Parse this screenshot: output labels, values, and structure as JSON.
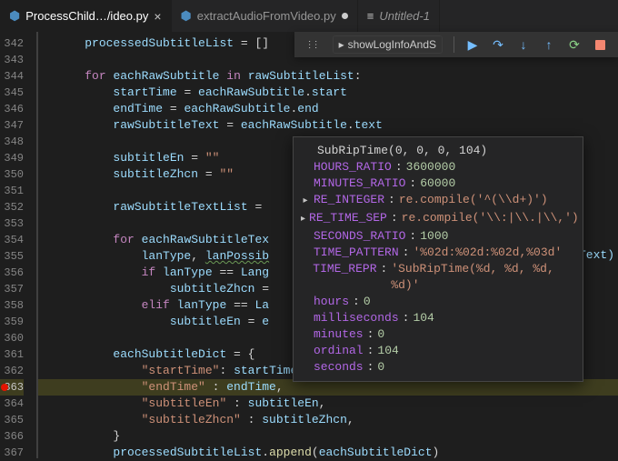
{
  "tabs": [
    {
      "icon": "py",
      "label": "ProcessChild…",
      "label2": "/ideo.py",
      "active": true,
      "close": true
    },
    {
      "icon": "py",
      "label": "extractAudioFromVideo.py",
      "modified": true
    },
    {
      "icon": "",
      "label": "Untitled-1",
      "italic": true
    }
  ],
  "debug": {
    "fnName": "showLogInfoAndS",
    "tri": "▸"
  },
  "lineStart": 342,
  "lines": [
    [
      {
        "cls": "var",
        "t": "processedSubtitleList"
      },
      {
        "cls": "op",
        "t": " = []"
      }
    ],
    [],
    [
      {
        "cls": "kw",
        "t": "for"
      },
      {
        "cls": "text",
        "t": " "
      },
      {
        "cls": "var",
        "t": "eachRawSubtitle"
      },
      {
        "cls": "text",
        "t": " "
      },
      {
        "cls": "kw",
        "t": "in"
      },
      {
        "cls": "text",
        "t": " "
      },
      {
        "cls": "var",
        "t": "rawSubtitleList"
      },
      {
        "cls": "punc",
        "t": ":"
      }
    ],
    [
      {
        "indent": 1
      },
      {
        "cls": "var",
        "t": "startTime"
      },
      {
        "cls": "op",
        "t": " = "
      },
      {
        "cls": "var",
        "t": "eachRawSubtitle"
      },
      {
        "cls": "punc",
        "t": "."
      },
      {
        "cls": "prop",
        "t": "start"
      }
    ],
    [
      {
        "indent": 1
      },
      {
        "cls": "var",
        "t": "endTime"
      },
      {
        "cls": "op",
        "t": " = "
      },
      {
        "cls": "var",
        "t": "eachRawSubtitle"
      },
      {
        "cls": "punc",
        "t": "."
      },
      {
        "cls": "prop",
        "t": "end"
      }
    ],
    [
      {
        "indent": 1
      },
      {
        "cls": "var",
        "t": "rawSubtitleText"
      },
      {
        "cls": "op",
        "t": " = "
      },
      {
        "cls": "var",
        "t": "eachRawSubtitle"
      },
      {
        "cls": "punc",
        "t": "."
      },
      {
        "cls": "prop",
        "t": "text"
      }
    ],
    [],
    [
      {
        "indent": 1
      },
      {
        "cls": "var",
        "t": "subtitleEn"
      },
      {
        "cls": "op",
        "t": " = "
      },
      {
        "cls": "str",
        "t": "\"\""
      }
    ],
    [
      {
        "indent": 1
      },
      {
        "cls": "var",
        "t": "subtitleZhcn"
      },
      {
        "cls": "op",
        "t": " = "
      },
      {
        "cls": "str",
        "t": "\"\""
      }
    ],
    [],
    [
      {
        "indent": 1
      },
      {
        "cls": "var",
        "t": "rawSubtitleTextList"
      },
      {
        "cls": "op",
        "t": " = "
      }
    ],
    [],
    [
      {
        "indent": 1
      },
      {
        "cls": "kw",
        "t": "for"
      },
      {
        "cls": "text",
        "t": " "
      },
      {
        "cls": "var",
        "t": "eachRawSubtitleTex"
      }
    ],
    [
      {
        "indent": 2
      },
      {
        "cls": "var",
        "t": "lanType"
      },
      {
        "cls": "punc",
        "t": ", "
      },
      {
        "cls": "var squiggle",
        "t": "lanPossib"
      }
    ],
    [
      {
        "indent": 2
      },
      {
        "cls": "kw",
        "t": "if"
      },
      {
        "cls": "text",
        "t": " "
      },
      {
        "cls": "var",
        "t": "lanType"
      },
      {
        "cls": "op",
        "t": " == "
      },
      {
        "cls": "var",
        "t": "Lang"
      }
    ],
    [
      {
        "indent": 3
      },
      {
        "cls": "var",
        "t": "subtitleZhcn"
      },
      {
        "cls": "op",
        "t": " ="
      }
    ],
    [
      {
        "indent": 2
      },
      {
        "cls": "kw",
        "t": "elif"
      },
      {
        "cls": "text",
        "t": " "
      },
      {
        "cls": "var",
        "t": "lanType"
      },
      {
        "cls": "op",
        "t": " == "
      },
      {
        "cls": "var",
        "t": "La"
      }
    ],
    [
      {
        "indent": 3
      },
      {
        "cls": "var",
        "t": "subtitleEn"
      },
      {
        "cls": "op",
        "t": " = "
      },
      {
        "cls": "var",
        "t": "e"
      }
    ],
    [],
    [
      {
        "indent": 1
      },
      {
        "cls": "var",
        "t": "eachSubtitleDict"
      },
      {
        "cls": "op",
        "t": " = {"
      }
    ],
    [
      {
        "indent": 2
      },
      {
        "cls": "str",
        "t": "\"startTime\""
      },
      {
        "cls": "punc",
        "t": ": "
      },
      {
        "cls": "var",
        "t": "startTime"
      },
      {
        "cls": "punc",
        "t": ","
      }
    ],
    [
      {
        "indent": 2
      },
      {
        "cls": "str",
        "t": "\"endTime\""
      },
      {
        "cls": "punc",
        "t": " : "
      },
      {
        "cls": "var",
        "t": "endTime"
      },
      {
        "cls": "punc",
        "t": ","
      }
    ],
    [
      {
        "indent": 2
      },
      {
        "cls": "str",
        "t": "\"subtitleEn\""
      },
      {
        "cls": "punc",
        "t": " : "
      },
      {
        "cls": "var",
        "t": "subtitleEn"
      },
      {
        "cls": "punc",
        "t": ","
      }
    ],
    [
      {
        "indent": 2
      },
      {
        "cls": "str",
        "t": "\"subtitleZhcn\""
      },
      {
        "cls": "punc",
        "t": " : "
      },
      {
        "cls": "var",
        "t": "subtitleZhcn"
      },
      {
        "cls": "punc",
        "t": ","
      }
    ],
    [
      {
        "indent": 1
      },
      {
        "cls": "punc",
        "t": "}"
      }
    ],
    [
      {
        "indent": 1
      },
      {
        "cls": "var",
        "t": "processedSubtitleList"
      },
      {
        "cls": "punc",
        "t": "."
      },
      {
        "cls": "fn",
        "t": "append"
      },
      {
        "cls": "punc",
        "t": "("
      },
      {
        "cls": "var",
        "t": "eachSubtitleDict"
      },
      {
        "cls": "punc",
        "t": ")"
      }
    ]
  ],
  "tailText": "eText)",
  "highlightLine": 363,
  "breakpointLine": 363,
  "popup": [
    {
      "tri": "",
      "key": "",
      "sep": "",
      "val_cls": "p-text",
      "val": "SubRipTime(0, 0, 0, 104)"
    },
    {
      "tri": "",
      "key": "HOURS_RATIO",
      "sep": ": ",
      "val_cls": "p-num",
      "val": "3600000"
    },
    {
      "tri": "",
      "key": "MINUTES_RATIO",
      "sep": ": ",
      "val_cls": "p-num",
      "val": "60000"
    },
    {
      "tri": "▸",
      "key": "RE_INTEGER",
      "sep": ": ",
      "val_cls": "p-str",
      "val": "re.compile('^(\\\\d+)')"
    },
    {
      "tri": "▸",
      "key": "RE_TIME_SEP",
      "sep": ": ",
      "val_cls": "p-str",
      "val": "re.compile('\\\\:|\\\\.|\\\\,')"
    },
    {
      "tri": "",
      "key": "SECONDS_RATIO",
      "sep": ": ",
      "val_cls": "p-num",
      "val": "1000"
    },
    {
      "tri": "",
      "key": "TIME_PATTERN",
      "sep": ": ",
      "val_cls": "p-str",
      "val": "'%02d:%02d:%02d,%03d'"
    },
    {
      "tri": "",
      "key": "TIME_REPR",
      "sep": ": ",
      "val_cls": "p-str",
      "val": "'SubRipTime(%d, %d, %d, %d)'"
    },
    {
      "tri": "",
      "key": "hours",
      "sep": ": ",
      "val_cls": "p-num",
      "val": "0"
    },
    {
      "tri": "",
      "key": "milliseconds",
      "sep": ": ",
      "val_cls": "p-num",
      "val": "104"
    },
    {
      "tri": "",
      "key": "minutes",
      "sep": ": ",
      "val_cls": "p-num",
      "val": "0"
    },
    {
      "tri": "",
      "key": "ordinal",
      "sep": ": ",
      "val_cls": "p-num",
      "val": "104"
    },
    {
      "tri": "",
      "key": "seconds",
      "sep": ": ",
      "val_cls": "p-num",
      "val": "0"
    }
  ]
}
